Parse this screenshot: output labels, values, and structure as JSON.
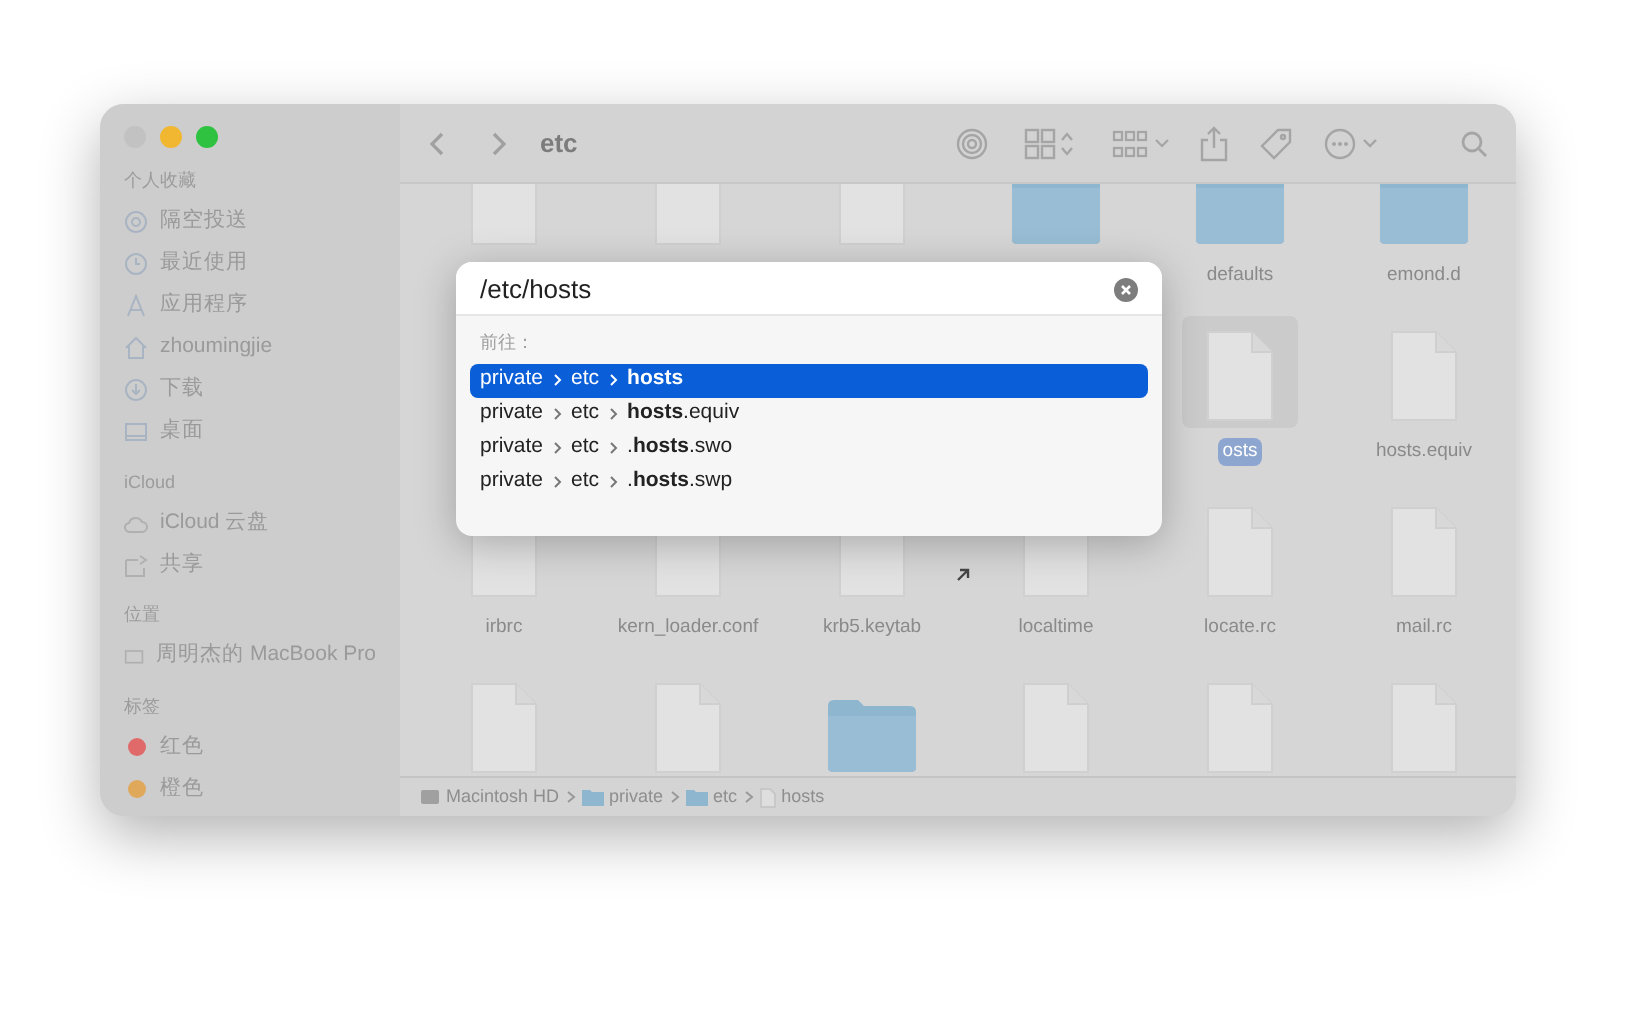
{
  "window": {
    "title": "etc"
  },
  "sidebar": {
    "sections": [
      {
        "heading": "个人收藏",
        "items": [
          {
            "label": "隔空投送"
          },
          {
            "label": "最近使用"
          },
          {
            "label": "应用程序"
          },
          {
            "label": "zhoumingjie"
          },
          {
            "label": "下载"
          },
          {
            "label": "桌面"
          }
        ]
      },
      {
        "heading": "iCloud",
        "items": [
          {
            "label": "iCloud 云盘"
          },
          {
            "label": "共享"
          }
        ]
      },
      {
        "heading": "位置",
        "items": [
          {
            "label": "周明杰的 MacBook Pro"
          }
        ]
      },
      {
        "heading": "标签",
        "items": [
          {
            "label": "红色",
            "color": "#e06a6a"
          },
          {
            "label": "橙色",
            "color": "#e0a85a"
          }
        ]
      }
    ]
  },
  "files": [
    [
      {
        "kind": "file"
      },
      {
        "kind": "file"
      },
      {
        "kind": "file"
      },
      {
        "kind": "folder"
      },
      {
        "kind": "folder",
        "label": "defaults"
      },
      {
        "kind": "folder",
        "label": "emond.d"
      }
    ],
    [
      {
        "kind": "file",
        "label": "osts",
        "selected": true
      },
      {
        "kind": "file",
        "label": "hosts.equiv",
        "selected": false
      }
    ],
    [
      {
        "kind": "file",
        "label": "irbrc"
      },
      {
        "kind": "file",
        "label": "kern_loader.conf"
      },
      {
        "kind": "file",
        "label": "krb5.keytab"
      },
      {
        "kind": "file",
        "label": "localtime"
      },
      {
        "kind": "file",
        "label": "locate.rc"
      },
      {
        "kind": "file",
        "label": "mail.rc"
      }
    ],
    [
      {
        "kind": "file"
      },
      {
        "kind": "file"
      },
      {
        "kind": "folder"
      },
      {
        "kind": "file"
      },
      {
        "kind": "file"
      },
      {
        "kind": "file"
      }
    ]
  ],
  "path_bar": [
    {
      "label": "Macintosh HD",
      "kind": "disk"
    },
    {
      "label": "private",
      "kind": "folder"
    },
    {
      "label": "etc",
      "kind": "folder"
    },
    {
      "label": "hosts",
      "kind": "file"
    }
  ],
  "go_to_dialog": {
    "value": "/etc/hosts",
    "heading": "前往：",
    "results": [
      {
        "parts": [
          "private",
          "etc"
        ],
        "name": "**hosts**",
        "selected": true
      },
      {
        "parts": [
          "private",
          "etc"
        ],
        "name": "**hosts**.equiv",
        "selected": false
      },
      {
        "parts": [
          "private",
          "etc"
        ],
        "name": ".**hosts**.swo",
        "selected": false
      },
      {
        "parts": [
          "private",
          "etc"
        ],
        "name": ".**hosts**.swp",
        "selected": false
      }
    ]
  }
}
